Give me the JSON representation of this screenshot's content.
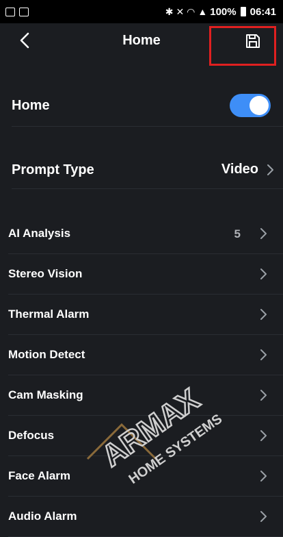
{
  "status_bar": {
    "battery": "100%",
    "time": "06:41"
  },
  "header": {
    "title": "Home"
  },
  "settings": {
    "home": {
      "label": "Home",
      "enabled": true
    },
    "prompt_type": {
      "label": "Prompt Type",
      "value": "Video"
    }
  },
  "menu": [
    {
      "label": "AI Analysis",
      "count": "5"
    },
    {
      "label": "Stereo Vision"
    },
    {
      "label": "Thermal Alarm"
    },
    {
      "label": "Motion Detect"
    },
    {
      "label": "Cam Masking"
    },
    {
      "label": "Defocus"
    },
    {
      "label": "Face Alarm"
    },
    {
      "label": "Audio Alarm"
    }
  ],
  "watermark": {
    "brand": "ARMAX",
    "tagline": "HOME SYSTEMS"
  },
  "colors": {
    "background": "#1b1d21",
    "accent": "#3e8ef7",
    "highlight": "#e02020"
  }
}
